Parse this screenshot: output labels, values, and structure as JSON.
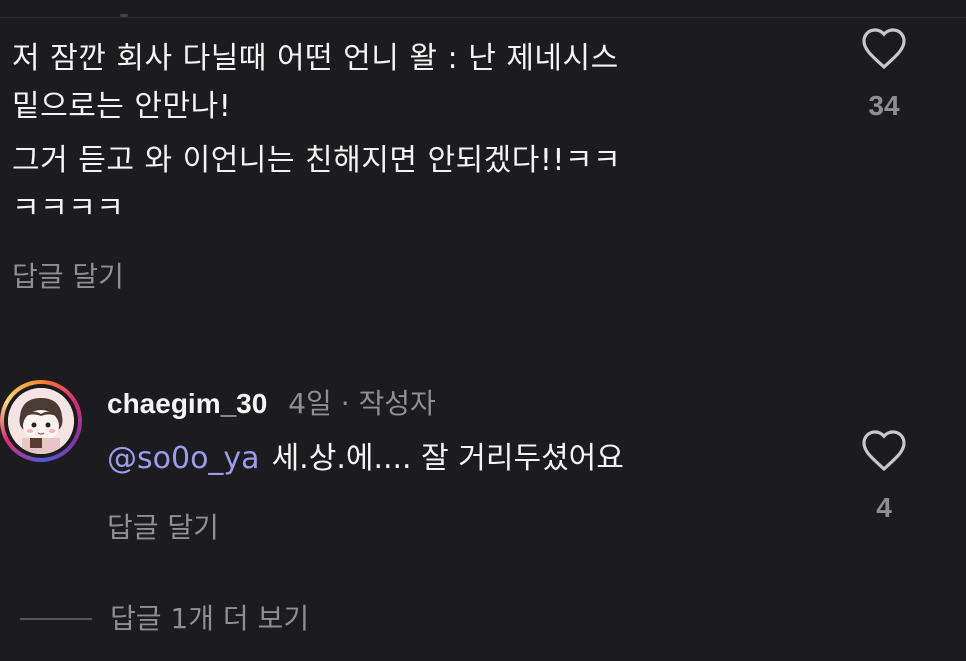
{
  "comment1": {
    "lines": [
      "저 잠깐 회사 다닐때 어떤 언니 왈 : 난 제네시스\n밑으로는 안만나!",
      "그거 듣고 와 이언니는 친해지면 안되겠다!!ㅋㅋ\nㅋㅋㅋㅋ"
    ],
    "reply_label": "답글 달기",
    "like_count": "34",
    "like_icon": "heart-outline-icon"
  },
  "reply": {
    "username": "chaegim_30",
    "meta": "4일 · 작성자",
    "mention": "@so0o_ya",
    "text": "세.상.에.... 잘 거리두셨어요",
    "reply_label": "답글 달기",
    "like_count": "4",
    "like_icon": "heart-outline-icon"
  },
  "more_replies_label": "답글 1개 더 보기",
  "colors": {
    "background": "#1c1c1e",
    "text": "#f4f4f4",
    "muted": "#8e8e93",
    "mention": "#9b9bf0"
  }
}
